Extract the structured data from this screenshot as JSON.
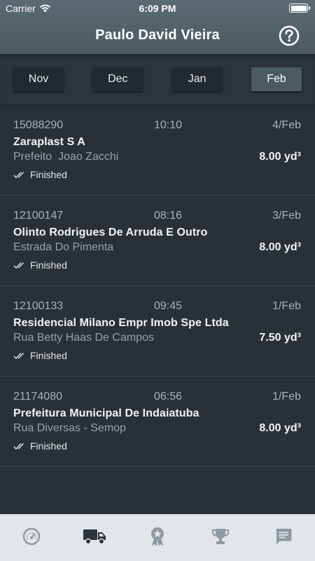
{
  "status_bar": {
    "carrier": "Carrier",
    "time": "6:09 PM"
  },
  "header": {
    "title": "Paulo David Vieira",
    "help_icon": "question-circle-icon"
  },
  "months": [
    {
      "label": "Nov",
      "active": false
    },
    {
      "label": "Dec",
      "active": false
    },
    {
      "label": "Jan",
      "active": false
    },
    {
      "label": "Feb",
      "active": true
    }
  ],
  "orders": [
    {
      "code": "15088290",
      "time": "10:10",
      "date": "4/Feb",
      "client": "Zaraplast S A",
      "address": "Prefeito  Joao Zacchi",
      "volume": "8.00 yd³",
      "status": "Finished"
    },
    {
      "code": "12100147",
      "time": "08:16",
      "date": "3/Feb",
      "client": "Olinto Rodrigues De Arruda E Outro",
      "address": "Estrada Do Pimenta",
      "volume": "8.00 yd³",
      "status": "Finished"
    },
    {
      "code": "12100133",
      "time": "09:45",
      "date": "1/Feb",
      "client": "Residencial Milano Empr Imob Spe Ltda",
      "address": "Rua Betty Haas De Campos",
      "volume": "7.50 yd³",
      "status": "Finished"
    },
    {
      "code": "21174080",
      "time": "06:56",
      "date": "1/Feb",
      "client": "Prefeitura Municipal De Indaiatuba",
      "address": "Rua Diversas - Semop",
      "volume": "8.00 yd³",
      "status": "Finished"
    }
  ],
  "tabbar": {
    "items": [
      {
        "icon": "speedometer-icon",
        "active": false
      },
      {
        "icon": "truck-icon",
        "active": true
      },
      {
        "icon": "award-ribbon-icon",
        "active": false
      },
      {
        "icon": "trophy-icon",
        "active": false
      },
      {
        "icon": "chat-message-icon",
        "active": false
      }
    ]
  },
  "colors": {
    "header": "#56646c",
    "background": "#293137",
    "month_button": "#222a2f",
    "month_button_active": "#4c5a62",
    "tabbar": "#e3e6e8",
    "tab_icon": "#8d9aa1",
    "tab_icon_active": "#2c353b"
  }
}
